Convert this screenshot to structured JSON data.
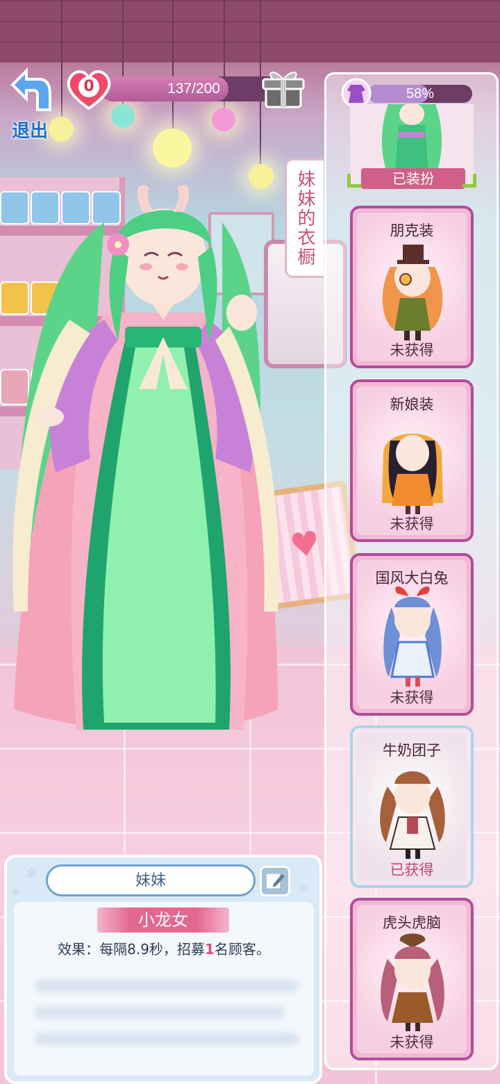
{
  "header": {
    "back_label": "退出",
    "hearts": "0",
    "progress_text": "137/200",
    "progress_value": 0.685
  },
  "wardrobe": {
    "tab_label": "妹妹的衣橱",
    "completion_text": "58%",
    "completion_value": 0.58,
    "equipped_label": "已装扮",
    "outfits": [
      {
        "name": "朋克装",
        "status": "未获得",
        "owned": false
      },
      {
        "name": "新娘装",
        "status": "未获得",
        "owned": false
      },
      {
        "name": "国风大白兔",
        "status": "未获得",
        "owned": false
      },
      {
        "name": "牛奶团子",
        "status": "已获得",
        "owned": true
      },
      {
        "name": "虎头虎脑",
        "status": "未获得",
        "owned": false
      }
    ]
  },
  "info": {
    "character_name": "妹妹",
    "outfit_title": "小龙女",
    "effect_prefix": "效果：每隔8.9秒，招募",
    "effect_count": "1",
    "effect_suffix": "名顾客。"
  },
  "colors": {
    "accent_pink": "#e4678f",
    "panel_border_locked": "#b14c9b",
    "panel_border_owned": "#a8d6ea",
    "equipped_corner": "#8ecc3c",
    "back_blue": "#1f6fc5"
  }
}
